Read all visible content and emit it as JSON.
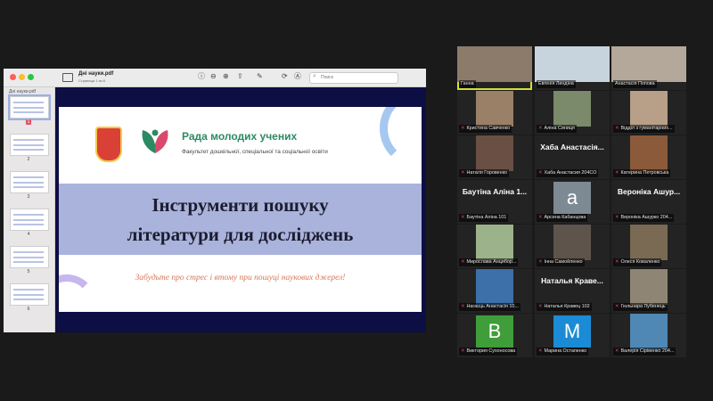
{
  "pdf": {
    "title": "Дні науки.pdf",
    "page_info": "Страница 1 из 6",
    "search_placeholder": "Поиск",
    "sidebar_title": "Дні науки.pdf",
    "thumbs": [
      {
        "page": "1",
        "selected": true
      },
      {
        "page": "2",
        "selected": false
      },
      {
        "page": "3",
        "selected": false
      },
      {
        "page": "4",
        "selected": false
      },
      {
        "page": "5",
        "selected": false
      },
      {
        "page": "6",
        "selected": false
      }
    ],
    "toolbar": {
      "info": "ⓘ",
      "zoom_out": "⊖",
      "zoom_in": "⊕",
      "share": "⇪",
      "markup": "✎",
      "rotate": "⟳",
      "annotate": "Ⓐ"
    }
  },
  "slide": {
    "council_name": "Рада молодих учених",
    "faculty": "Факультет дошкільної, спеціальної та соціальної освіти",
    "heading_line1": "Інструменти пошуку",
    "heading_line2": "літератури для досліджень",
    "tagline": "Забудьте про стрес і втому при пошуці наукових джерел!"
  },
  "participants": [
    {
      "name": "Ганна",
      "type": "video",
      "active": true,
      "color": "#8c7b6b"
    },
    {
      "name": "Евгенія Линдіна",
      "type": "video",
      "color": "#c8d4dd"
    },
    {
      "name": "Анастасія Попова",
      "type": "video",
      "color": "#b4a89a"
    },
    {
      "name": "Кристина Савченко",
      "type": "video",
      "muted": true,
      "color": "#9a8066"
    },
    {
      "name": "Аліна Синиця",
      "type": "video",
      "muted": true,
      "color": "#7a8a6a"
    },
    {
      "name": "Відділ з гуманітарних...",
      "type": "video",
      "muted": true,
      "color": "#b79f88"
    },
    {
      "name": "Наталя Горовенко",
      "type": "video",
      "muted": true,
      "color": "#6a4f44"
    },
    {
      "name": "Хаба Анастасия 204CO",
      "type": "name",
      "display": "Хаба Анастасія...",
      "muted": true
    },
    {
      "name": "Катерина Петровська",
      "type": "video",
      "muted": true,
      "color": "#8a5a3a"
    },
    {
      "name": "Баутіна Аліна 101",
      "type": "name",
      "display": "Баутіна Аліна 1...",
      "muted": true
    },
    {
      "name": "Арсена Кабанцова",
      "type": "avatar",
      "letter": "a",
      "color": "#7d8a93",
      "muted": true
    },
    {
      "name": "Вероніка Ашурко 204...",
      "type": "name",
      "display": "Вероніка Ашур...",
      "muted": true
    },
    {
      "name": "Мирослава Анцибор...",
      "type": "video",
      "muted": true,
      "color": "#9cb28a"
    },
    {
      "name": "Інна Самойленко",
      "type": "video",
      "muted": true,
      "color": "#5e544c"
    },
    {
      "name": "Олеся Коваленко",
      "type": "video",
      "muted": true,
      "color": "#7a6a54"
    },
    {
      "name": "Нагаєць Анастасія 10...",
      "type": "video",
      "muted": true,
      "color": "#3d6fa8"
    },
    {
      "name": "Наталья Кравец 102",
      "type": "name",
      "display": "Наталья Краве...",
      "muted": true
    },
    {
      "name": "Гюльнара Лубенець",
      "type": "video",
      "muted": true,
      "color": "#8f8574"
    },
    {
      "name": "Виктория Сухоносова",
      "type": "avatar",
      "letter": "B",
      "color": "#3f9e3a",
      "muted": true
    },
    {
      "name": "Марина Остапенко",
      "type": "avatar",
      "letter": "M",
      "color": "#1c8bd6",
      "muted": true
    },
    {
      "name": "Валерія Сірівенко 204...",
      "type": "video",
      "muted": true,
      "color": "#4f88b5"
    }
  ]
}
